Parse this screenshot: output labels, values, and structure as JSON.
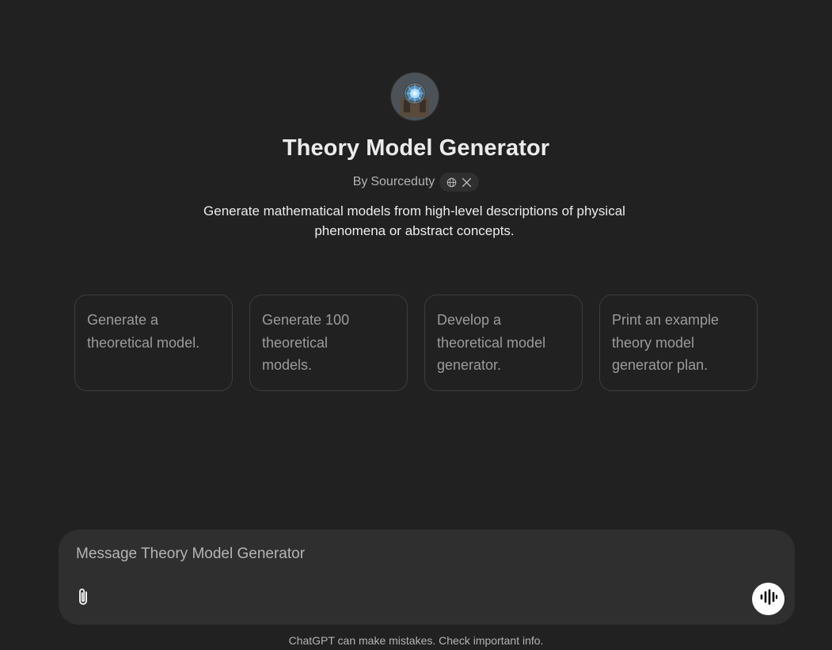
{
  "gpt": {
    "title": "Theory Model Generator",
    "by_prefix": "By",
    "author": "Sourceduty",
    "description_line1": "Generate mathematical models from high-level descriptions of physical",
    "description_line2": "phenomena or abstract concepts.",
    "social_icons": [
      "globe-icon",
      "x-logo-icon"
    ]
  },
  "starters": [
    {
      "label": "Generate a theoretical model."
    },
    {
      "label": "Generate 100 theoretical models."
    },
    {
      "label": "Develop a theoretical model generator."
    },
    {
      "label": "Print an example theory model generator plan."
    }
  ],
  "composer": {
    "placeholder": "Message Theory Model Generator",
    "value": "",
    "attach_icon": "paperclip-icon",
    "voice_icon": "voice-waveform-icon"
  },
  "footer": {
    "note": "ChatGPT can make mistakes. Check important info."
  },
  "colors": {
    "background": "#212121",
    "composer_bg": "#2f2f2f",
    "card_border": "#3d3d3d",
    "text_primary": "#ececec",
    "text_secondary": "#b4b4b4",
    "card_text": "#9b9b9b"
  }
}
